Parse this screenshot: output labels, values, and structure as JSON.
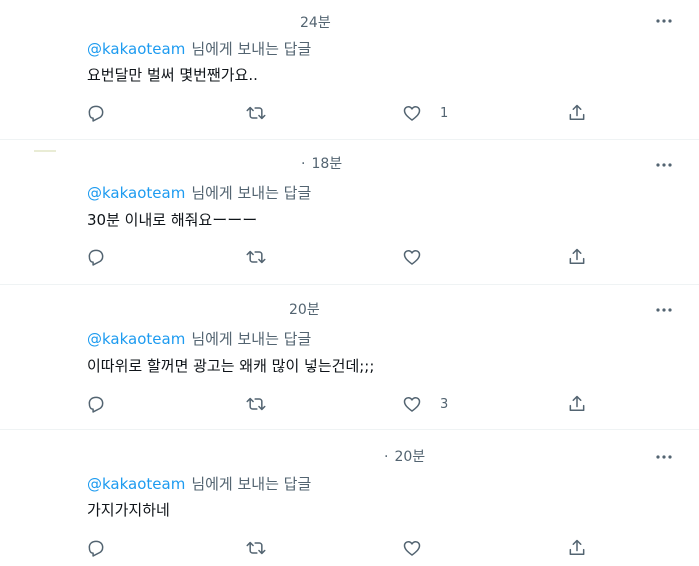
{
  "tweets": [
    {
      "time": "24분",
      "time_prefix": "",
      "reply_handle": "@kakaoteam",
      "reply_suffix": "님에게 보내는 답글",
      "text": "요번달만 벌써 몇번짼가요..",
      "reply_count": "",
      "retweet_count": "",
      "like_count": "1"
    },
    {
      "time": "18분",
      "time_prefix": "·",
      "reply_handle": "@kakaoteam",
      "reply_suffix": "님에게 보내는 답글",
      "text": "30분 이내로 해줘요ーーー",
      "reply_count": "",
      "retweet_count": "",
      "like_count": ""
    },
    {
      "time": "20분",
      "time_prefix": "",
      "reply_handle": "@kakaoteam",
      "reply_suffix": "님에게 보내는 답글",
      "text": "이따위로 할꺼면 광고는 왜캐 많이 넣는건데;;;",
      "reply_count": "",
      "retweet_count": "",
      "like_count": "3"
    },
    {
      "time": "20분",
      "time_prefix": "·",
      "reply_handle": "@kakaoteam",
      "reply_suffix": "님에게 보내는 답글",
      "text": "가지가지하네",
      "reply_count": "",
      "retweet_count": "",
      "like_count": ""
    }
  ],
  "icons": {
    "more": "more-horizontal-icon",
    "reply": "reply-icon",
    "retweet": "retweet-icon",
    "like": "heart-icon",
    "share": "share-icon"
  },
  "colors": {
    "handle": "#1d9bf0",
    "secondary_text": "#536471",
    "primary_text": "#0f1419",
    "divider": "#eff3f4"
  }
}
